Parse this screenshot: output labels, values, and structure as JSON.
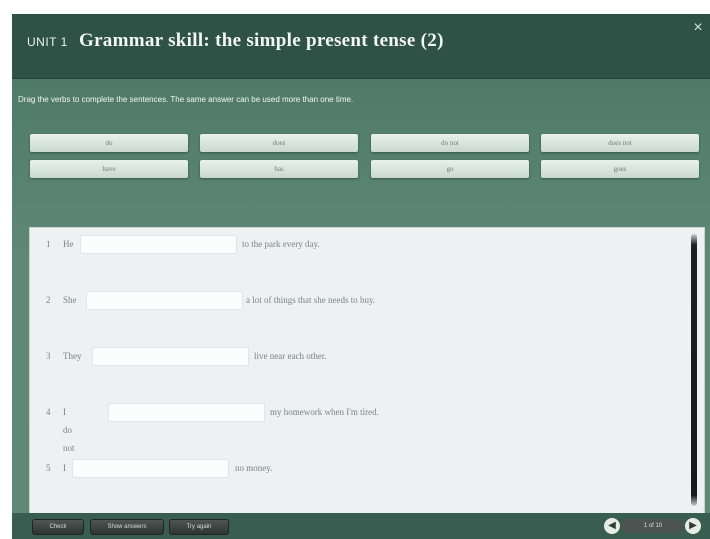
{
  "header": {
    "unit_label": "UNIT 1",
    "title": "Grammar skill: the simple present tense (2)",
    "close_glyph": "×"
  },
  "instruction": "Drag the verbs to complete the sentences. The same answer can be used more than one time.",
  "word_bank": [
    "do",
    "does",
    "do not",
    "does not",
    "have",
    "has",
    "go",
    "goes"
  ],
  "sentences": [
    {
      "num": "1",
      "before": "He",
      "after": "to the park every day."
    },
    {
      "num": "2",
      "before": "She",
      "after": "a lot of things that she needs to buy."
    },
    {
      "num": "3",
      "before": "They",
      "after": "live near each other."
    },
    {
      "num": "4",
      "before": "I do not",
      "after": "my homework when I'm tired."
    },
    {
      "num": "5",
      "before": "I",
      "after": "no money."
    }
  ],
  "footer": {
    "check": "Check",
    "show_answers": "Show answers",
    "try_again": "Try again",
    "page_indicator": "1 of 10"
  },
  "colors": {
    "header_bg": "#2e5245",
    "body_bg": "#5f8878",
    "panel_bg": "#edf1f1"
  },
  "icons": {
    "close": "close-icon",
    "prev": "arrow-left-icon",
    "next": "arrow-right-icon"
  }
}
